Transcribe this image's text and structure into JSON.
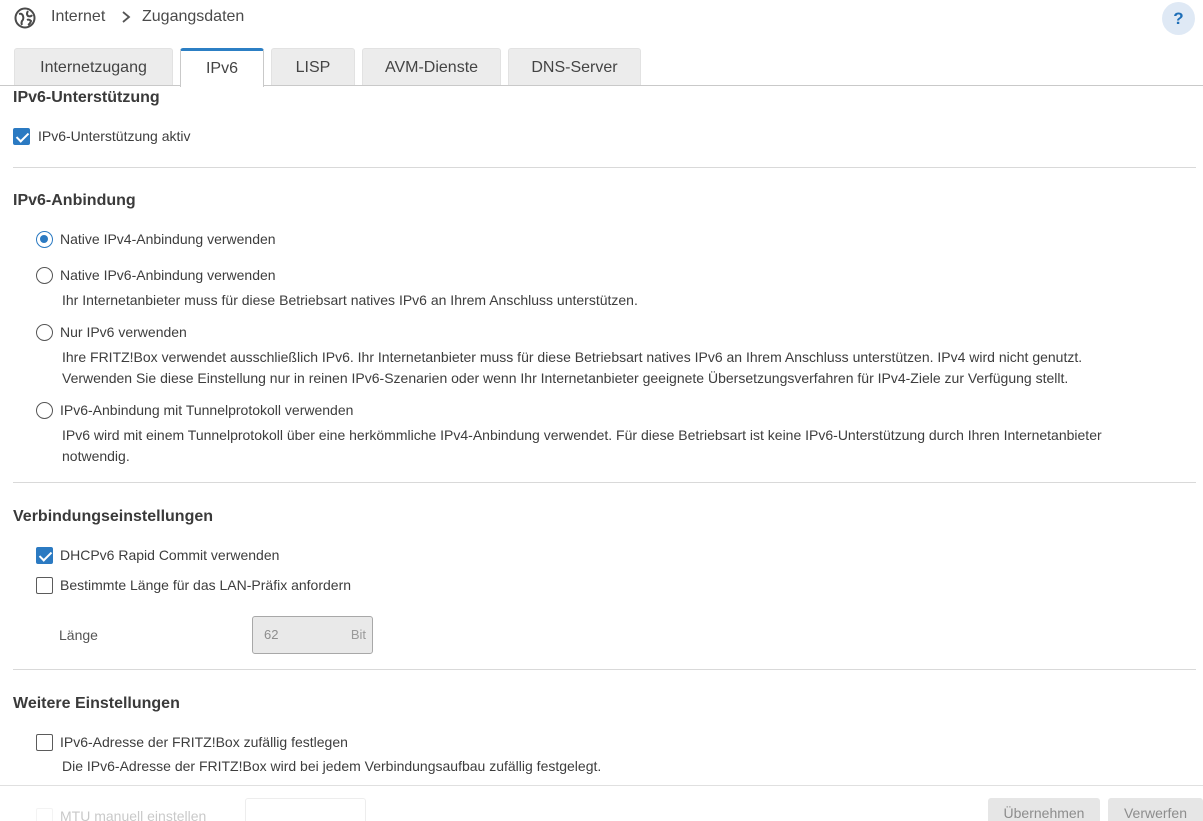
{
  "breadcrumb": {
    "section": "Internet",
    "page": "Zugangsdaten"
  },
  "help": {
    "label": "?"
  },
  "tabs": [
    {
      "label": "Internetzugang",
      "active": false
    },
    {
      "label": "IPv6",
      "active": true
    },
    {
      "label": "LISP",
      "active": false
    },
    {
      "label": "AVM-Dienste",
      "active": false
    },
    {
      "label": "DNS-Server",
      "active": false
    }
  ],
  "support": {
    "title": "IPv6-Unterstützung",
    "checkbox_label": "IPv6-Unterstützung aktiv",
    "checked": true
  },
  "connection": {
    "title": "IPv6-Anbindung",
    "options": [
      {
        "label": "Native IPv4-Anbindung verwenden",
        "selected": true,
        "desc": []
      },
      {
        "label": "Native IPv6-Anbindung verwenden",
        "selected": false,
        "desc": [
          "Ihr Internetanbieter muss für diese Betriebsart natives IPv6 an Ihrem Anschluss unterstützen."
        ]
      },
      {
        "label": "Nur IPv6 verwenden",
        "selected": false,
        "desc": [
          "Ihre FRITZ!Box verwendet ausschließlich IPv6. Ihr Internetanbieter muss für diese Betriebsart natives IPv6 an Ihrem Anschluss unterstützen. IPv4 wird nicht genutzt.",
          "Verwenden Sie diese Einstellung nur in reinen IPv6-Szenarien oder wenn Ihr Internetanbieter geeignete Übersetzungsverfahren für IPv4-Ziele zur Verfügung stellt."
        ]
      },
      {
        "label": "IPv6-Anbindung mit Tunnelprotokoll verwenden",
        "selected": false,
        "desc": [
          "IPv6 wird mit einem Tunnelprotokoll über eine herkömmliche IPv4-Anbindung verwendet. Für diese Betriebsart ist keine IPv6-Unterstützung durch Ihren Internetanbieter",
          "notwendig."
        ]
      }
    ]
  },
  "settings": {
    "title": "Verbindungseinstellungen",
    "rapid_commit_label": "DHCPv6 Rapid Commit verwenden",
    "rapid_commit_checked": true,
    "prefix_label": "Bestimmte Länge für das LAN-Präfix anfordern",
    "prefix_checked": false,
    "length_label": "Länge",
    "length_value": "62",
    "length_unit": "Bit"
  },
  "more": {
    "title": "Weitere Einstellungen",
    "random_label": "IPv6-Adresse der FRITZ!Box zufällig festlegen",
    "random_checked": false,
    "random_desc": "Die IPv6-Adresse der FRITZ!Box wird bei jedem Verbindungsaufbau zufällig festgelegt.",
    "mtu_label": "MTU manuell einstellen"
  },
  "actions": {
    "apply": "Übernehmen",
    "discard": "Verwerfen"
  },
  "colors": {
    "accent": "#2b7ac2",
    "help_bg": "#dfe9f5"
  }
}
